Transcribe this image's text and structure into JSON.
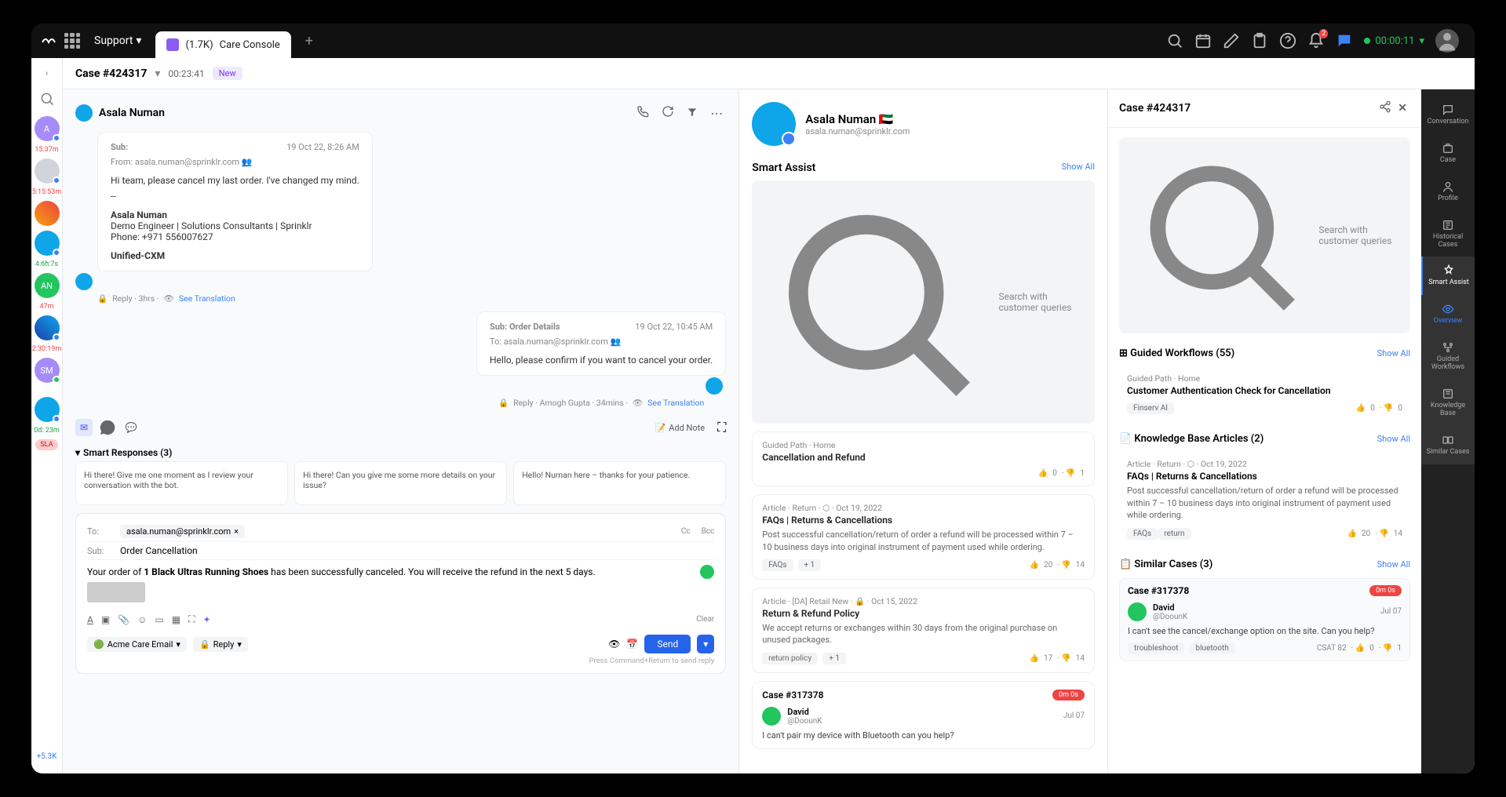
{
  "topbar": {
    "menu": "Support",
    "tab_count": "(1.7K)",
    "tab_title": "Care Console",
    "notif_count": "2",
    "timer": "00:00:11"
  },
  "case_header": {
    "id": "Case #424317",
    "duration": "00:23:41",
    "status": "New"
  },
  "queue": [
    {
      "label": "A",
      "time": "15:37m",
      "cls": "purple"
    },
    {
      "label": "",
      "time": "5:15:53m",
      "cls": "gray"
    },
    {
      "label": "",
      "time": "",
      "cls": "img"
    },
    {
      "label": "",
      "time": "4:6h:7s",
      "cls": "blue"
    },
    {
      "label": "AN",
      "time": "47m",
      "cls": "green"
    },
    {
      "label": "",
      "time": "2:30:19m",
      "cls": "img2"
    },
    {
      "label": "SM",
      "time": "",
      "cls": "purple"
    },
    {
      "label": "",
      "time": "0d: 23m",
      "cls": "blue"
    }
  ],
  "queue_sla": "SLA",
  "queue_more": "+5.3K",
  "conversation": {
    "name": "Asala Numan",
    "msg1": {
      "sub": "Sub:",
      "from_label": "From:",
      "from": "asala.numan@sprinklr.com",
      "date": "19 Oct 22, 8:26 AM",
      "body": "Hi team, please cancel my last order. I've changed my mind.",
      "sig_name": "Asala Numan",
      "sig_title": "Demo Engineer | Solutions Consultants | Sprinklr",
      "sig_phone": "Phone: +971 556007627",
      "sig_tag": "Unified-CXM"
    },
    "meta1": "Reply · 3hrs · ",
    "meta1_link": "See Translation",
    "msg2": {
      "sub": "Sub: Order Details",
      "to_label": "To:",
      "to": "asala.numan@sprinklr.com",
      "date": "19 Oct 22, 10:45 AM",
      "body": "Hello, please confirm if you want to cancel your order."
    },
    "meta2": "Reply · Amogh Gupta · 34mins · ",
    "meta2_link": "See Translation",
    "add_note": "Add Note"
  },
  "smart_responses": {
    "title": "Smart Responses (3)",
    "items": [
      "Hi there! Give me one moment as I review your conversation with the bot.",
      "Hi there! Can you give me some more details on your issue?",
      "Hello! Numan here – thanks for your patience."
    ]
  },
  "compose": {
    "to_label": "To:",
    "to_chip": "asala.numan@sprinklr.com",
    "cc": "Cc",
    "bcc": "Bcc",
    "sub_label": "Sub:",
    "sub": "Order Cancellation",
    "body_pre": "Your order of ",
    "body_bold": "1 Black Ultras Running Shoes",
    "body_post": " has been successfully canceled. You will receive the refund in the next 5 days.",
    "clear": "Clear",
    "from": "Acme Care Email",
    "reply": "Reply",
    "send": "Send",
    "hint": "Press Command+Return to send reply"
  },
  "profile": {
    "name": "Asala Numan",
    "email": "asala.numan@sprinklr.com"
  },
  "smart_assist": {
    "title": "Smart Assist",
    "show_all": "Show All",
    "search_ph": "Search with customer queries",
    "cards": [
      {
        "crumb": "Guided Path · Home",
        "title": "Cancellation and Refund",
        "votes_up": "0",
        "votes_dn": "1"
      },
      {
        "crumb": "Article · Return · ⬡ · Oct 19, 2022",
        "title": "FAQs | Returns & Cancellations",
        "desc": "Post successful cancellation/return of order a refund will be processed within 7 – 10 business days into original instrument of payment used while ordering.",
        "tag1": "FAQs",
        "tag2": "+ 1",
        "votes_up": "20",
        "votes_dn": "14"
      },
      {
        "crumb": "Article · [DA] Retail New · 🔒 · Oct 15, 2022",
        "title": "Return & Refund Policy",
        "desc": "We accept returns or exchanges within 30 days from the original purchase on unused packages.",
        "tag1": "return policy",
        "tag2": "+ 1",
        "votes_up": "17",
        "votes_dn": "14"
      }
    ],
    "case": {
      "id": "Case #317378",
      "pill": "0m 0s",
      "user": "David",
      "handle": "@DoounK",
      "date": "Jul 07",
      "text": "I can't pair my device with Bluetooth can you help?"
    }
  },
  "right_panel": {
    "title": "Case #424317",
    "search_ph": "Search with customer queries",
    "s1_title": "Guided Workflows (55)",
    "show_all": "Show All",
    "wf": {
      "crumb": "Guided Path · Home",
      "title": "Customer Authentication Check for Cancellation",
      "chip": "Finserv AI",
      "up": "0",
      "dn": "0"
    },
    "s2_title": "Knowledge Base Articles (2)",
    "kb": {
      "crumb": "Article · Return · ⬡ · Oct 19, 2022",
      "title": "FAQs | Returns & Cancellations",
      "desc": "Post successful cancellation/return of order a refund will be processed within 7 – 10 business days into original instrument of payment used while ordering.",
      "tag1": "FAQs",
      "tag2": "return",
      "up": "20",
      "dn": "14"
    },
    "s3_title": "Similar Cases (3)",
    "sc": {
      "id": "Case #317378",
      "pill": "0m 0s",
      "user": "David",
      "handle": "@DoounK",
      "date": "Jul 07",
      "text": "I can't see the cancel/exchange option on the site. Can you help?",
      "tag1": "troubleshoot",
      "tag2": "bluetooth",
      "csat": "CSAT 82",
      "up": "0",
      "dn": "1"
    }
  },
  "right_rail": [
    "Conversation",
    "Case",
    "Profile",
    "Historical Cases",
    "Smart Assist",
    "Overview",
    "Guided Workflows",
    "Knowledge Base",
    "Similar Cases"
  ]
}
